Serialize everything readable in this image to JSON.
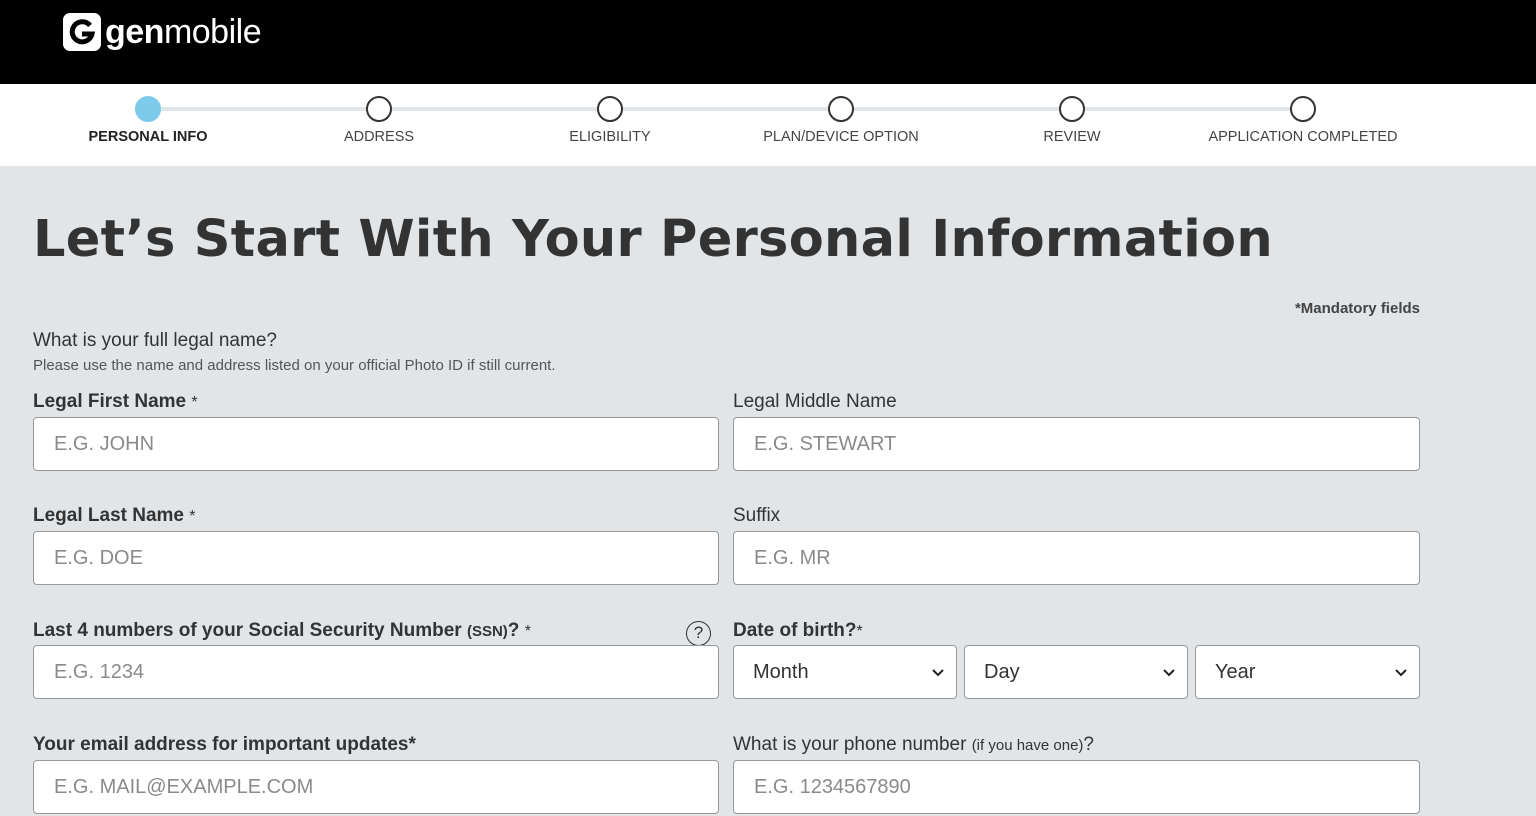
{
  "brand": {
    "bold": "gen",
    "light": "mobile"
  },
  "stepper": {
    "steps": [
      {
        "label": "PERSONAL INFO",
        "active": true
      },
      {
        "label": "ADDRESS",
        "active": false
      },
      {
        "label": "ELIGIBILITY",
        "active": false
      },
      {
        "label": "PLAN/DEVICE OPTION",
        "active": false
      },
      {
        "label": "REVIEW",
        "active": false
      },
      {
        "label": "APPLICATION COMPLETED",
        "active": false
      }
    ]
  },
  "page": {
    "title": "Let’s Start With Your Personal Information",
    "mandatory_note": "*Mandatory fields",
    "name_question": "What is your full legal name?",
    "name_helper": "Please use the name and address listed on your official Photo ID if still current."
  },
  "form": {
    "first_name": {
      "label": "Legal First Name",
      "required_mark": "*",
      "placeholder": "E.G. JOHN",
      "value": ""
    },
    "middle_name": {
      "label": "Legal Middle Name",
      "placeholder": "E.G. STEWART",
      "value": ""
    },
    "last_name": {
      "label": "Legal Last Name",
      "required_mark": "*",
      "placeholder": "E.G. DOE",
      "value": ""
    },
    "suffix": {
      "label": "Suffix",
      "placeholder": "E.G. MR",
      "value": ""
    },
    "ssn": {
      "label": "Last 4 numbers of your Social Security Number",
      "label_abbr": "(SSN)",
      "label_end": "?",
      "required_mark": "*",
      "help": "?",
      "placeholder": "E.G. 1234",
      "value": ""
    },
    "dob": {
      "label": "Date of birth?",
      "required_mark": "*",
      "month": "Month",
      "day": "Day",
      "year": "Year"
    },
    "email": {
      "label": "Your email address for important updates*",
      "placeholder": "E.G. MAIL@EXAMPLE.COM",
      "value": ""
    },
    "phone": {
      "label": "What is your phone number",
      "label_note": "(if you have one)",
      "label_end": "?",
      "placeholder": "E.G. 1234567890",
      "value": ""
    }
  },
  "colors": {
    "header_bg": "#000000",
    "active_step": "#7ccbea",
    "page_bg": "#e1e5e8"
  }
}
